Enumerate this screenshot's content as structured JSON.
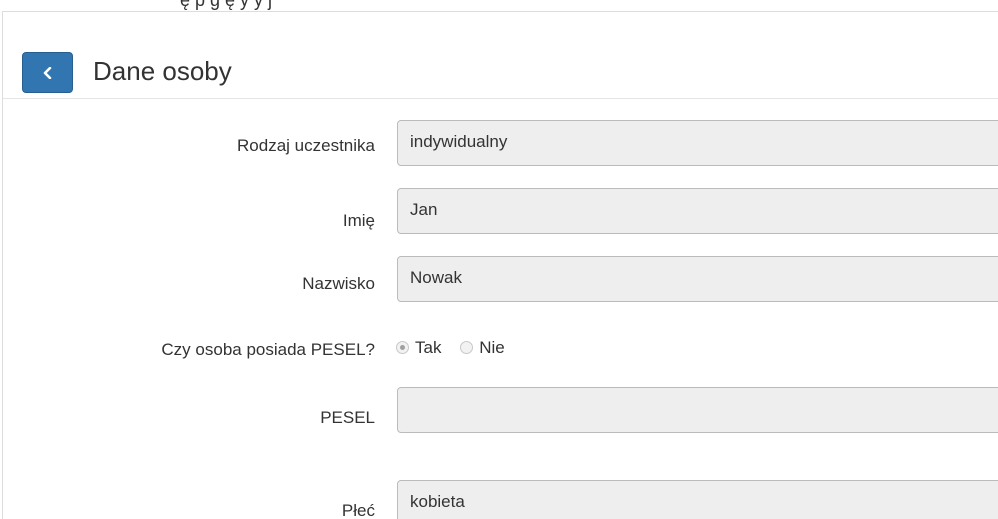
{
  "header": {
    "top_text": "ę p  g ę      y                   y j",
    "back_label": "<",
    "title": "Dane osoby"
  },
  "form": {
    "rodzaj": {
      "label": "Rodzaj uczestnika",
      "value": "indywidualny"
    },
    "imie": {
      "label": "Imię",
      "value": "Jan"
    },
    "nazwisko": {
      "label": "Nazwisko",
      "value": "Nowak"
    },
    "pesel_question": {
      "label": "Czy osoba posiada PESEL?",
      "options": [
        "Tak",
        "Nie"
      ],
      "selected": "Tak"
    },
    "pesel": {
      "label": "PESEL",
      "value": ""
    },
    "plec": {
      "label": "Płeć",
      "value": "kobieta"
    }
  },
  "colors": {
    "primary": "#3276b1",
    "input_bg": "#eeeeee"
  }
}
